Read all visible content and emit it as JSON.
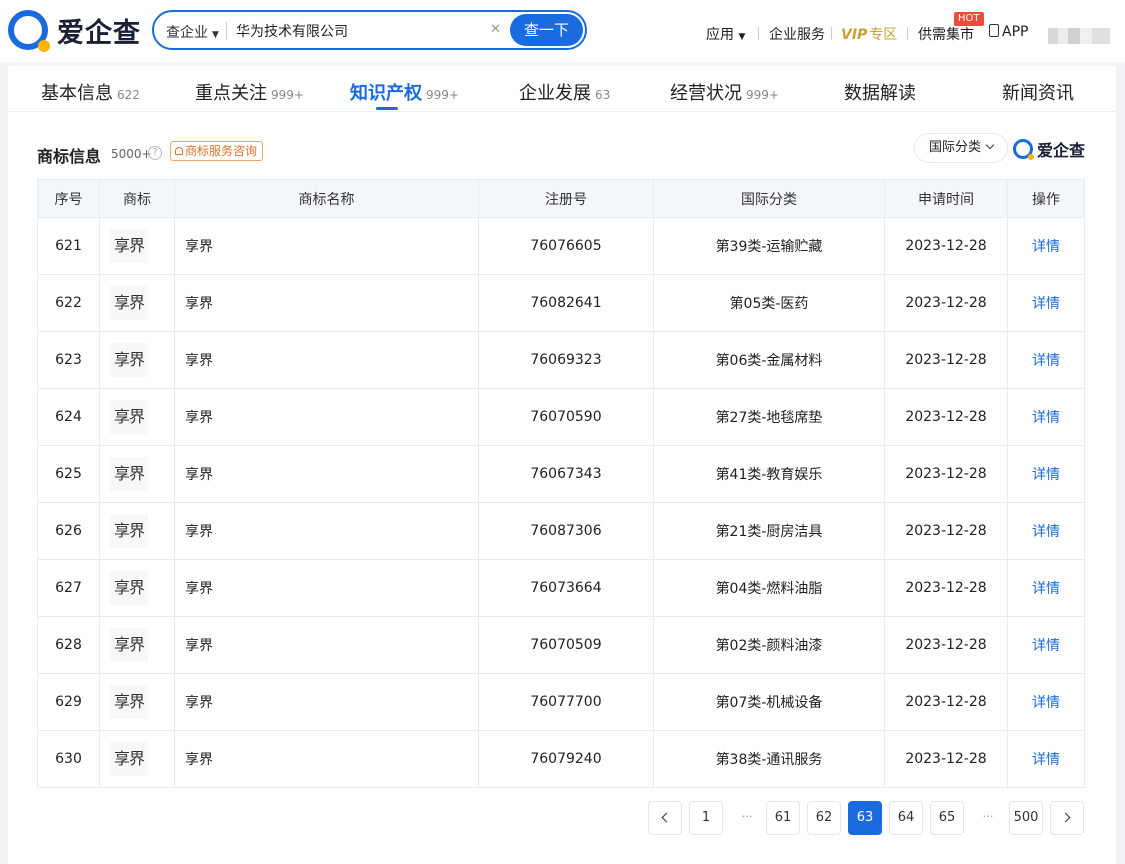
{
  "brand": {
    "name": "爱企查"
  },
  "search": {
    "scope": "查企业",
    "value": "华为技术有限公司",
    "button": "查一下"
  },
  "nav": {
    "app_menu": "应用",
    "enterprise_service": "企业服务",
    "vip": "VIP",
    "vip_zone": "专区",
    "supply_demand": "供需集市",
    "hot_badge": "HOT",
    "app": "APP"
  },
  "tabs": [
    {
      "label": "基本信息",
      "count": "622"
    },
    {
      "label": "重点关注",
      "count": "999+"
    },
    {
      "label": "知识产权",
      "count": "999+",
      "active": true
    },
    {
      "label": "企业发展",
      "count": "63"
    },
    {
      "label": "经营状况",
      "count": "999+"
    },
    {
      "label": "数据解读",
      "count": ""
    },
    {
      "label": "新闻资讯",
      "count": ""
    }
  ],
  "section": {
    "title": "商标信息",
    "count": "5000+",
    "help": "?",
    "consult": "商标服务咨询",
    "filter": "国际分类",
    "watermark": "爱企查"
  },
  "table": {
    "headers": [
      "序号",
      "商标",
      "商标名称",
      "注册号",
      "国际分类",
      "申请时间",
      "操作"
    ],
    "rows": [
      {
        "no": "621",
        "mark": "享界",
        "name": "享界",
        "reg": "76076605",
        "cls": "第39类-运输贮藏",
        "date": "2023-12-28",
        "action": "详情"
      },
      {
        "no": "622",
        "mark": "享界",
        "name": "享界",
        "reg": "76082641",
        "cls": "第05类-医药",
        "date": "2023-12-28",
        "action": "详情"
      },
      {
        "no": "623",
        "mark": "享界",
        "name": "享界",
        "reg": "76069323",
        "cls": "第06类-金属材料",
        "date": "2023-12-28",
        "action": "详情"
      },
      {
        "no": "624",
        "mark": "享界",
        "name": "享界",
        "reg": "76070590",
        "cls": "第27类-地毯席垫",
        "date": "2023-12-28",
        "action": "详情"
      },
      {
        "no": "625",
        "mark": "享界",
        "name": "享界",
        "reg": "76067343",
        "cls": "第41类-教育娱乐",
        "date": "2023-12-28",
        "action": "详情"
      },
      {
        "no": "626",
        "mark": "享界",
        "name": "享界",
        "reg": "76087306",
        "cls": "第21类-厨房洁具",
        "date": "2023-12-28",
        "action": "详情"
      },
      {
        "no": "627",
        "mark": "享界",
        "name": "享界",
        "reg": "76073664",
        "cls": "第04类-燃料油脂",
        "date": "2023-12-28",
        "action": "详情"
      },
      {
        "no": "628",
        "mark": "享界",
        "name": "享界",
        "reg": "76070509",
        "cls": "第02类-颜料油漆",
        "date": "2023-12-28",
        "action": "详情"
      },
      {
        "no": "629",
        "mark": "享界",
        "name": "享界",
        "reg": "76077700",
        "cls": "第07类-机械设备",
        "date": "2023-12-28",
        "action": "详情"
      },
      {
        "no": "630",
        "mark": "享界",
        "name": "享界",
        "reg": "76079240",
        "cls": "第38类-通讯服务",
        "date": "2023-12-28",
        "action": "详情"
      }
    ]
  },
  "pagination": {
    "pages": [
      "1",
      "…",
      "61",
      "62",
      "63",
      "64",
      "65",
      "…",
      "500"
    ],
    "current": "63"
  }
}
